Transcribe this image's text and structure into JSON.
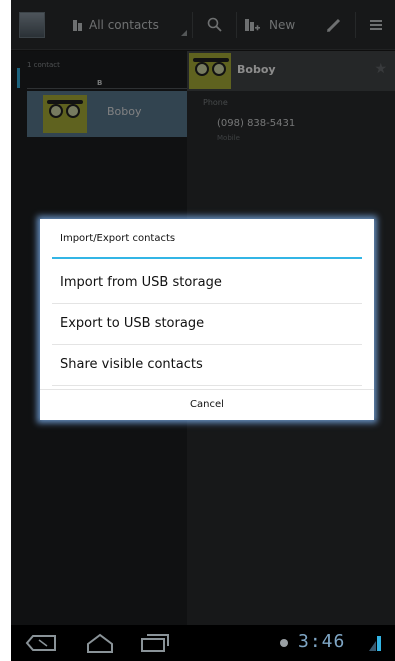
{
  "action_bar": {
    "filter_label": "All contacts",
    "new_label": "New",
    "icons": [
      "app-icon",
      "people-icon",
      "search-icon",
      "add-contact-icon",
      "edit-pencil-icon",
      "overflow-menu-icon"
    ]
  },
  "contact_list": {
    "count_label": "1 contact",
    "section_letter": "B",
    "items": [
      {
        "name": "Boboy",
        "selected": true
      }
    ]
  },
  "contact_detail": {
    "name": "Boboy",
    "field_label": "Phone",
    "phone": "(098) 838-5431",
    "phone_type": "Mobile"
  },
  "dialog": {
    "title": "Import/Export contacts",
    "items": [
      "Import from USB storage",
      "Export to USB storage",
      "Share visible contacts"
    ],
    "cancel_label": "Cancel"
  },
  "system_bar": {
    "time": "3:46",
    "icons": [
      "back-icon",
      "home-icon",
      "recent-apps-icon",
      "notification-dot-icon",
      "signal-icon"
    ]
  },
  "colors": {
    "accent": "#33b5e5",
    "selected_row": "#5c7c93",
    "action_bar": "#2b2d2e"
  }
}
